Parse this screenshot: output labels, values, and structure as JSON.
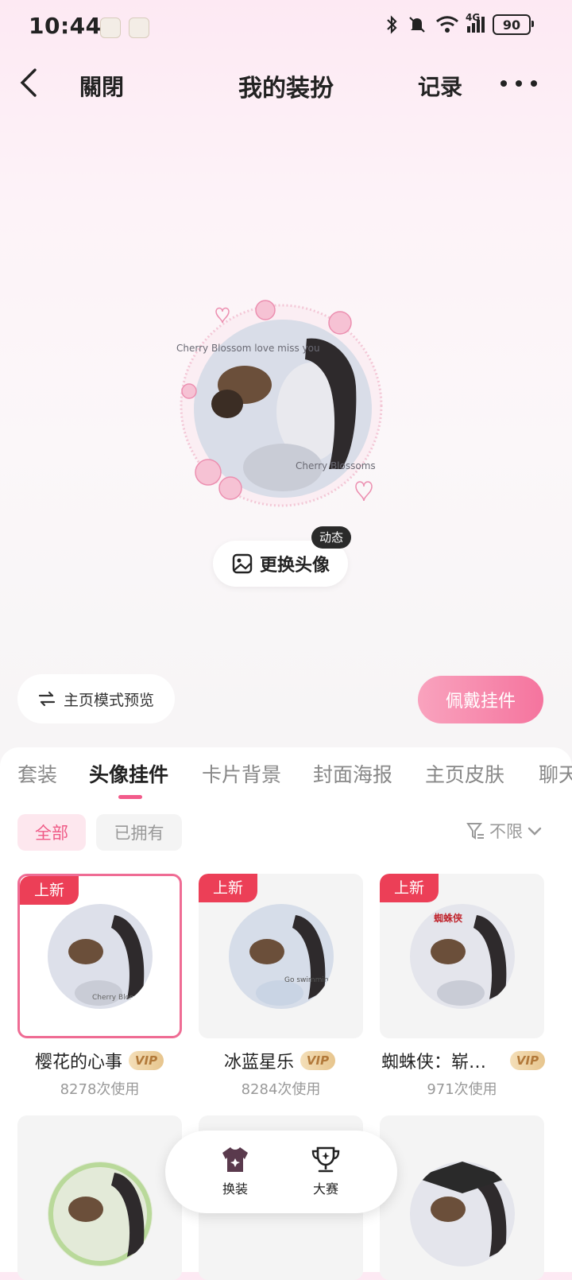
{
  "status_bar": {
    "time": "10:44",
    "network": "4G",
    "battery": "90",
    "icons": [
      "bluetooth-icon",
      "mute-icon",
      "wifi-icon",
      "signal-icon",
      "battery-icon"
    ]
  },
  "nav": {
    "close_label": "關閉",
    "title": "我的装扮",
    "record_label": "记录"
  },
  "avatar": {
    "frame_text_top": "Cherry Blossom love miss you",
    "frame_text_bottom": "Cherry Blossoms",
    "change_label": "更换头像",
    "dynamic_badge": "动态"
  },
  "actions": {
    "preview_mode_label": "主页模式预览",
    "wear_label": "佩戴挂件"
  },
  "tabs": [
    {
      "label": "套装",
      "active": false
    },
    {
      "label": "头像挂件",
      "active": true
    },
    {
      "label": "卡片背景",
      "active": false
    },
    {
      "label": "封面海报",
      "active": false
    },
    {
      "label": "主页皮肤",
      "active": false
    },
    {
      "label": "聊天",
      "active": false
    }
  ],
  "filters": {
    "chips": [
      "全部",
      "已拥有"
    ],
    "sort_label": "不限"
  },
  "items": [
    {
      "name": "樱花的心事",
      "vip": "VIP",
      "uses": "8278次使用",
      "badge": "上新",
      "selected": true,
      "art_text": "Cherry Blossoms"
    },
    {
      "name": "冰蓝星乐",
      "vip": "VIP",
      "uses": "8284次使用",
      "badge": "上新",
      "selected": false,
      "art_text": "Go swimming"
    },
    {
      "name": "蜘蛛侠：崭…",
      "vip": "VIP",
      "uses": "971次使用",
      "badge": "上新",
      "selected": false,
      "art_text": "蜘蛛侠"
    }
  ],
  "dock": {
    "items": [
      {
        "label": "换装",
        "icon": "outfit-icon"
      },
      {
        "label": "大赛",
        "icon": "trophy-icon"
      }
    ]
  },
  "colors": {
    "accent": "#ef5a86",
    "new_badge": "#ec3f57",
    "vip_gold": "#e7c58d"
  }
}
